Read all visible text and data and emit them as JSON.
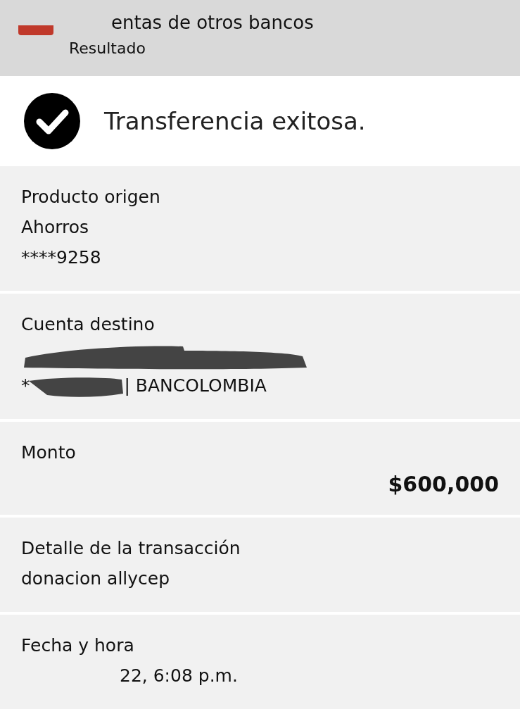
{
  "header": {
    "title": "entas de otros bancos",
    "subtitle": "Resultado"
  },
  "status": {
    "kind": "success",
    "message": "Transferencia exitosa."
  },
  "sections": [
    {
      "kind": "lines",
      "label": "Producto origen",
      "lines": [
        "Ahorros",
        "****9258"
      ]
    },
    {
      "kind": "account",
      "label": "Cuenta destino",
      "prefix": "*",
      "bank": "| BANCOLOMBIA"
    },
    {
      "kind": "amount",
      "label": "Monto",
      "value": "$600,000"
    },
    {
      "kind": "lines",
      "label": "Detalle de la transacción",
      "lines": [
        "donacion allycep"
      ]
    },
    {
      "kind": "date",
      "label": "Fecha y hora",
      "value": "22, 6:08 p.m."
    }
  ]
}
